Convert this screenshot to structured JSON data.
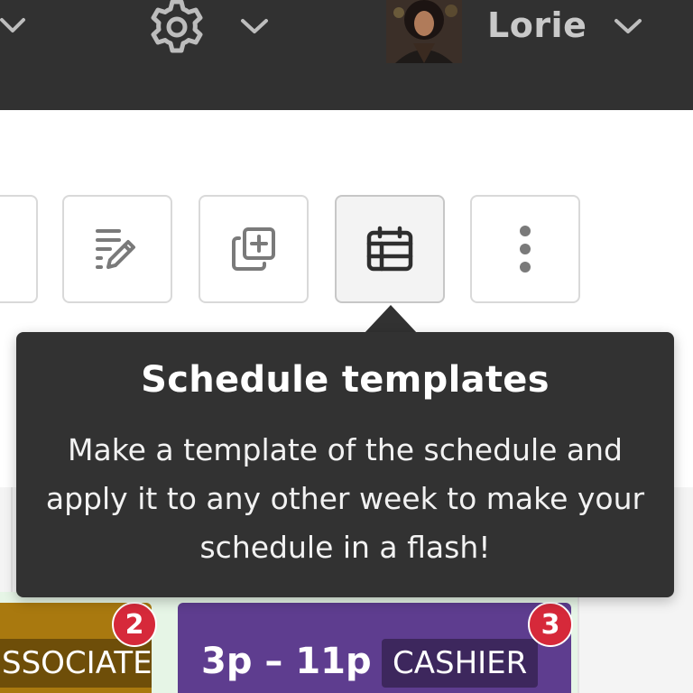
{
  "topbar": {
    "user_name": "Lorie",
    "icons": [
      "chevron-down-icon",
      "gear-icon",
      "chevron-down-icon",
      "avatar",
      "chevron-down-icon"
    ]
  },
  "toolbar": {
    "buttons": [
      {
        "name": "edit-list-button",
        "icon": "edit-list-icon"
      },
      {
        "name": "duplicate-button",
        "icon": "copy-add-icon"
      },
      {
        "name": "schedule-templates-button",
        "icon": "calendar-template-icon",
        "active": true
      },
      {
        "name": "more-options-button",
        "icon": "more-vertical-icon"
      }
    ]
  },
  "tooltip": {
    "title": "Schedule templates",
    "body": "Make a template of the schedule and apply it to any other week to make your schedule in a flash!"
  },
  "shifts": [
    {
      "role": "SSOCIATE",
      "badge": "2",
      "color": "#a9790f"
    },
    {
      "time": "3p – 11p",
      "role": "CASHIER",
      "badge": "3",
      "color": "#5e3d8f"
    }
  ],
  "colors": {
    "topbar": "#313131",
    "tooltip": "#323232",
    "badge": "#d6293a"
  }
}
